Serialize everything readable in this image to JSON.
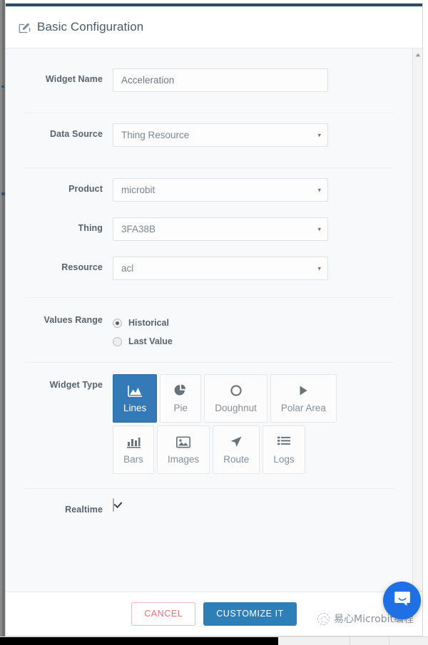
{
  "modal": {
    "title": "Basic Configuration",
    "title_icon": "edit-pencil-icon"
  },
  "form": {
    "widget_name": {
      "label": "Widget Name",
      "value": "Acceleration",
      "placeholder": "Widget Name"
    },
    "data_source": {
      "label": "Data Source",
      "value": "Thing Resource",
      "caret": "▾"
    },
    "product": {
      "label": "Product",
      "value": "microbit",
      "caret": "▾"
    },
    "thing": {
      "label": "Thing",
      "value": "3FA38B",
      "caret": "▾"
    },
    "resource": {
      "label": "Resource",
      "value": "acl",
      "caret": "▾"
    },
    "values_range": {
      "label": "Values Range",
      "options": [
        {
          "label": "Historical",
          "selected": true
        },
        {
          "label": "Last Value",
          "selected": false
        }
      ]
    },
    "widget_type": {
      "label": "Widget Type",
      "row1": [
        {
          "label": "Lines",
          "icon": "area-chart-icon",
          "active": true
        },
        {
          "label": "Pie",
          "icon": "pie-chart-icon",
          "active": false
        },
        {
          "label": "Doughnut",
          "icon": "circle-outline-icon",
          "active": false
        },
        {
          "label": "Polar Area",
          "icon": "play-triangle-icon",
          "active": false
        }
      ],
      "row2": [
        {
          "label": "Bars",
          "icon": "bar-chart-icon",
          "active": false
        },
        {
          "label": "Images",
          "icon": "image-icon",
          "active": false
        },
        {
          "label": "Route",
          "icon": "location-arrow-icon",
          "active": false
        },
        {
          "label": "Logs",
          "icon": "list-icon",
          "active": false
        }
      ]
    },
    "realtime": {
      "label": "Realtime",
      "checked": true
    }
  },
  "footer": {
    "cancel_label": "CANCEL",
    "submit_label": "CUSTOMIZE IT"
  },
  "watermark": {
    "text": "易心Microbit编程",
    "logo": "watermark-logo-icon"
  },
  "chat": {
    "launcher_icon": "intercom-chat-icon"
  },
  "scrollbars": {
    "vertical_up_arrow": "scroll-up-arrow-icon"
  },
  "colors": {
    "accent": "#337ab7",
    "primary_button": "#2e7fb8",
    "cancel_text": "#e0707c",
    "header_border": "#2d4c63",
    "body_bg": "#f8f9fa",
    "chat_blue": "#1f6fe5"
  }
}
